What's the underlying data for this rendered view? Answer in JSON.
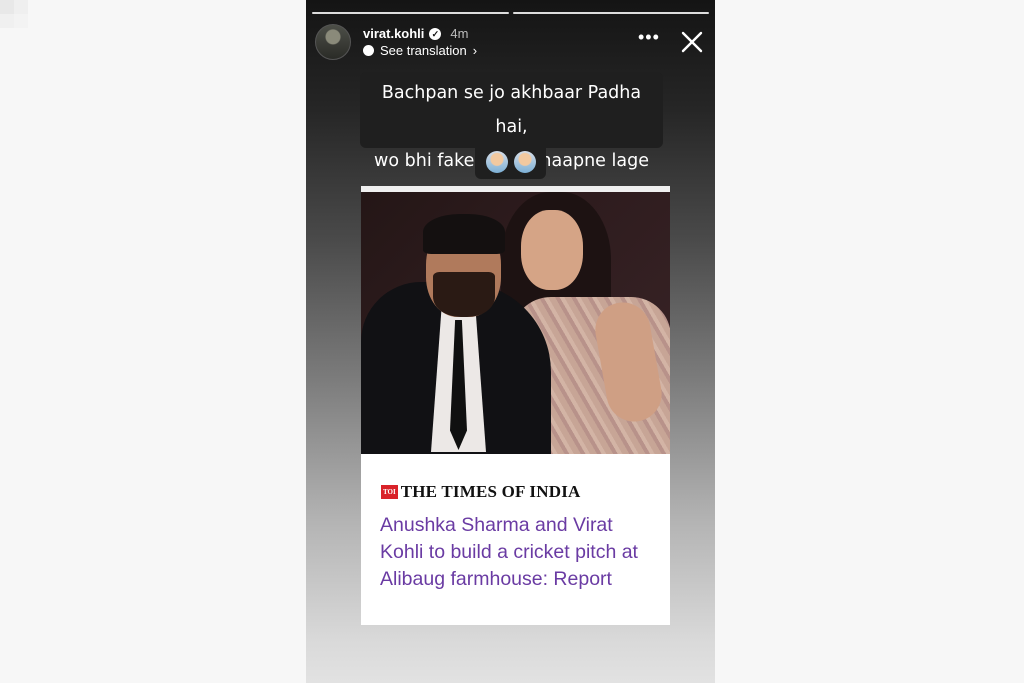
{
  "story": {
    "username": "virat.kohli",
    "time": "4m",
    "see_translation": "See translation",
    "more_icon": "more-horizontal-icon",
    "close_icon": "close-icon",
    "caption_line1": "Bachpan se jo akhbaar Padha hai,",
    "caption_line2": "wo bhi fake news chaapne lage ab",
    "emojis": [
      "man-facepalming-emoji",
      "man-shrugging-emoji"
    ]
  },
  "article": {
    "brand_badge": "TOI",
    "brand_name": "THE TIMES OF INDIA",
    "headline": "Anushka Sharma and Virat Kohli to build a cricket pitch at Alibaug farmhouse: Report"
  }
}
